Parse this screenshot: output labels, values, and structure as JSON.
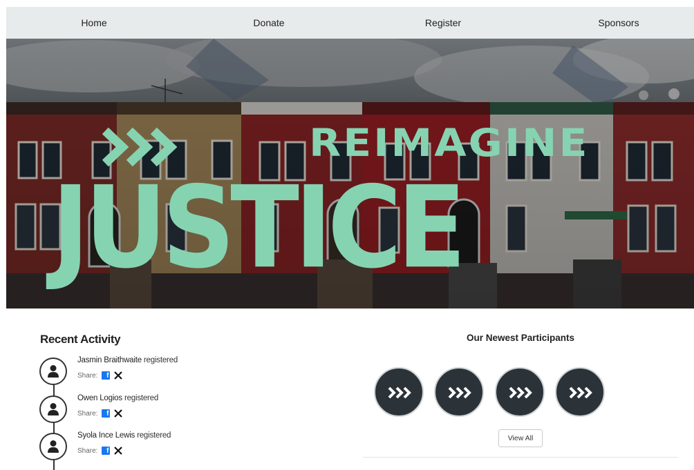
{
  "nav": {
    "items": [
      {
        "label": "Home"
      },
      {
        "label": "Donate"
      },
      {
        "label": "Register"
      },
      {
        "label": "Sponsors"
      }
    ]
  },
  "hero": {
    "word_top": "REIMAGINE",
    "word_main": "JUSTICE",
    "accent_color": "#86d3b2",
    "logo_icon": "triple-chevron-icon"
  },
  "recent_activity": {
    "title": "Recent Activity",
    "share_label": "Share:",
    "items": [
      {
        "name": "Jasmin Braithwaite",
        "verb": "registered"
      },
      {
        "name": "Owen Logios",
        "verb": "registered"
      },
      {
        "name": "Syola Ince Lewis",
        "verb": "registered"
      }
    ]
  },
  "participants": {
    "title": "Our Newest Participants",
    "view_all_label": "View All",
    "avatar_color": "#2b3238",
    "count_shown": 4
  }
}
